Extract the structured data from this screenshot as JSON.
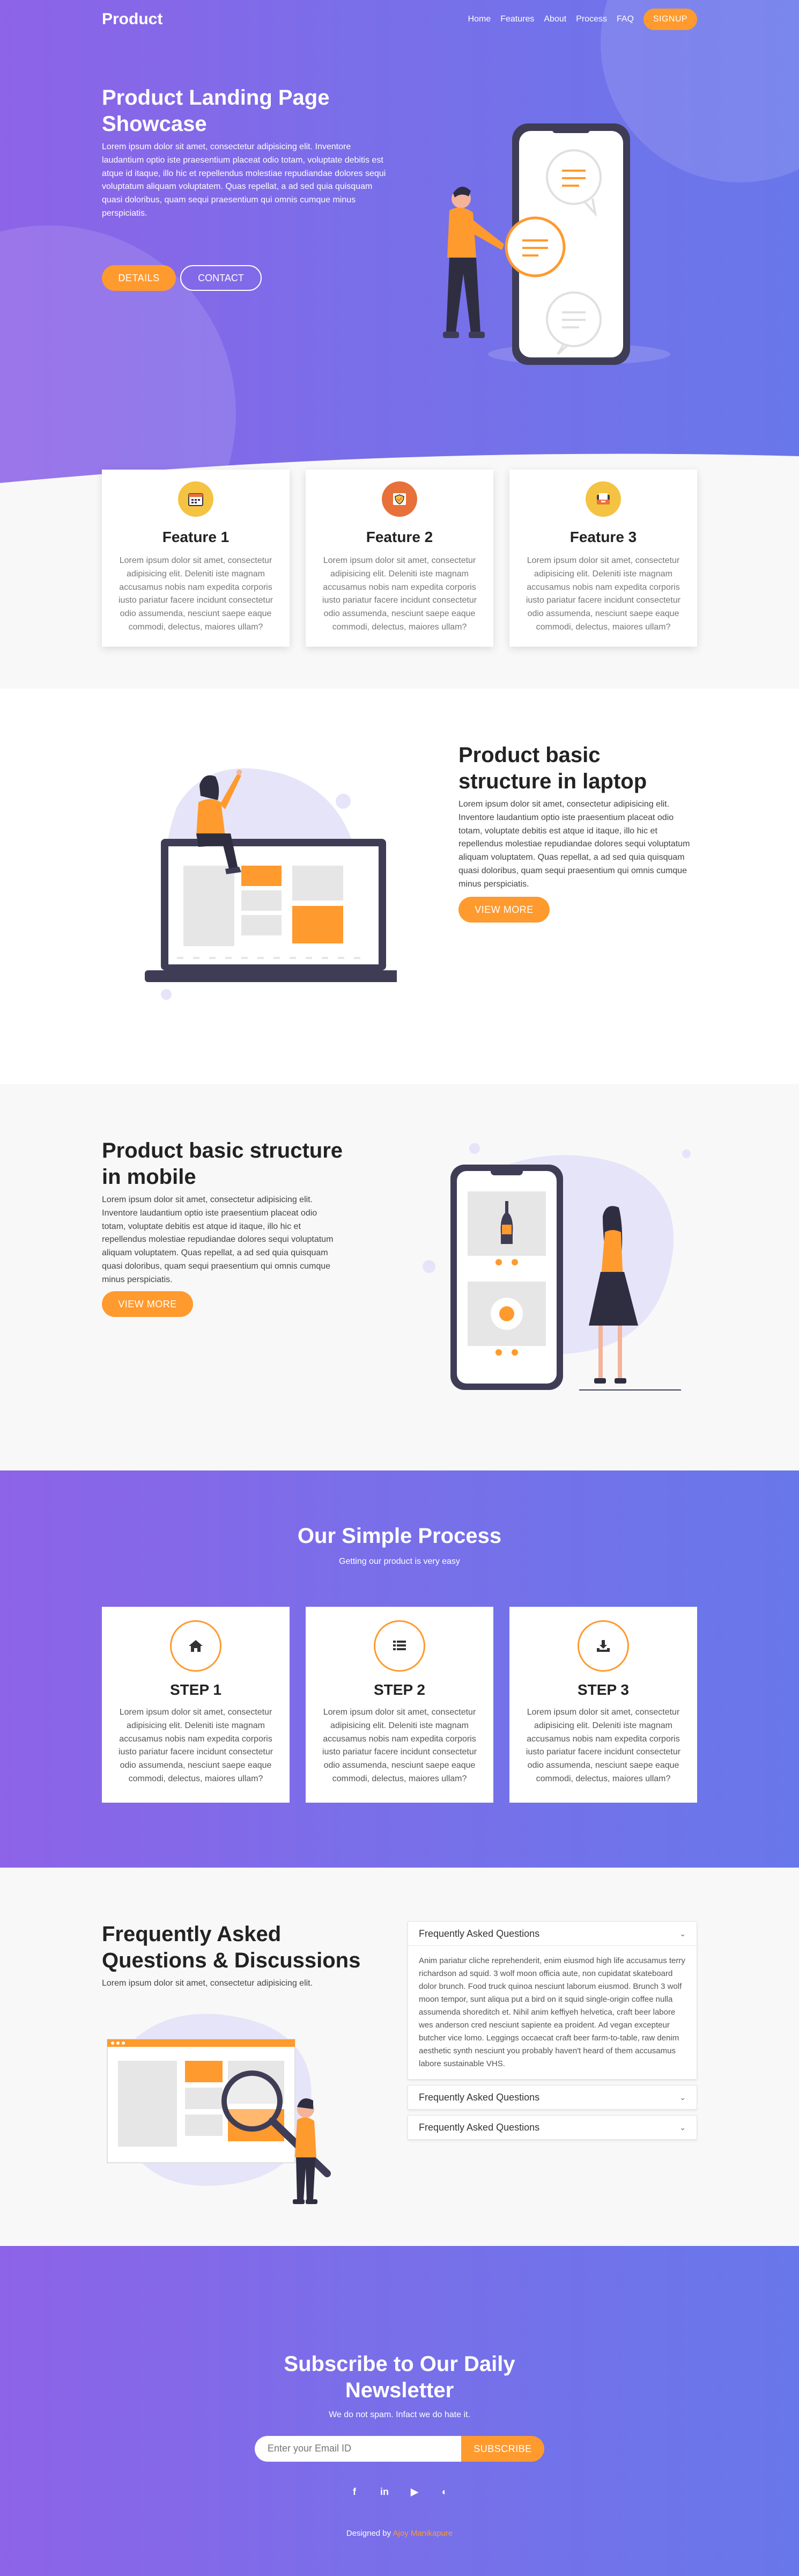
{
  "brand": "Product",
  "nav": {
    "items": [
      "Home",
      "Features",
      "About",
      "Process",
      "FAQ"
    ],
    "signup": "SIGNUP"
  },
  "hero": {
    "title": "Product Landing Page Showcase",
    "text": "Lorem ipsum dolor sit amet, consectetur adipisicing elit. Inventore laudantium optio iste praesentium placeat odio totam, voluptate debitis est atque id itaque, illo hic et repellendus molestiae repudiandae dolores sequi voluptatum aliquam voluptatem. Quas repellat, a ad sed quia quisquam quasi doloribus, quam sequi praesentium qui omnis cumque minus perspiciatis.",
    "details_btn": "DETAILS",
    "contact_btn": "CONTACT"
  },
  "features": [
    {
      "title": "Feature 1",
      "icon": "calendar-icon",
      "color": "#f5c342",
      "text": "Lorem ipsum dolor sit amet, consectetur adipisicing elit. Deleniti iste magnam accusamus nobis nam expedita corporis iusto pariatur facere incidunt consectetur odio assumenda, nesciunt saepe eaque commodi, delectus, maiores ullam?"
    },
    {
      "title": "Feature 2",
      "icon": "shield-icon",
      "color": "#e8703a",
      "text": "Lorem ipsum dolor sit amet, consectetur adipisicing elit. Deleniti iste magnam accusamus nobis nam expedita corporis iusto pariatur facere incidunt consectetur odio assumenda, nesciunt saepe eaque commodi, delectus, maiores ullam?"
    },
    {
      "title": "Feature 3",
      "icon": "inbox-icon",
      "color": "#f5c342",
      "text": "Lorem ipsum dolor sit amet, consectetur adipisicing elit. Deleniti iste magnam accusamus nobis nam expedita corporis iusto pariatur facere incidunt consectetur odio assumenda, nesciunt saepe eaque commodi, delectus, maiores ullam?"
    }
  ],
  "laptop": {
    "title": "Product basic structure in laptop",
    "text": "Lorem ipsum dolor sit amet, consectetur adipisicing elit. Inventore laudantium optio iste praesentium placeat odio totam, voluptate debitis est atque id itaque, illo hic et repellendus molestiae repudiandae dolores sequi voluptatum aliquam voluptatem. Quas repellat, a ad sed quia quisquam quasi doloribus, quam sequi praesentium qui omnis cumque minus perspiciatis.",
    "btn": "VIEW MORE"
  },
  "mobile": {
    "title": "Product basic structure in mobile",
    "text": "Lorem ipsum dolor sit amet, consectetur adipisicing elit. Inventore laudantium optio iste praesentium placeat odio totam, voluptate debitis est atque id itaque, illo hic et repellendus molestiae repudiandae dolores sequi voluptatum aliquam voluptatem. Quas repellat, a ad sed quia quisquam quasi doloribus, quam sequi praesentium qui omnis cumque minus perspiciatis.",
    "btn": "VIEW MORE"
  },
  "process": {
    "title": "Our Simple Process",
    "subtitle": "Getting our product is very easy",
    "steps": [
      {
        "title": "STEP 1",
        "icon": "home-icon",
        "text": "Lorem ipsum dolor sit amet, consectetur adipisicing elit. Deleniti iste magnam accusamus nobis nam expedita corporis iusto pariatur facere incidunt consectetur odio assumenda, nesciunt saepe eaque commodi, delectus, maiores ullam?"
      },
      {
        "title": "STEP 2",
        "icon": "list-icon",
        "text": "Lorem ipsum dolor sit amet, consectetur adipisicing elit. Deleniti iste magnam accusamus nobis nam expedita corporis iusto pariatur facere incidunt consectetur odio assumenda, nesciunt saepe eaque commodi, delectus, maiores ullam?"
      },
      {
        "title": "STEP 3",
        "icon": "download-icon",
        "text": "Lorem ipsum dolor sit amet, consectetur adipisicing elit. Deleniti iste magnam accusamus nobis nam expedita corporis iusto pariatur facere incidunt consectetur odio assumenda, nesciunt saepe eaque commodi, delectus, maiores ullam?"
      }
    ]
  },
  "faq": {
    "title": "Frequently Asked Questions & Discussions",
    "text": "Lorem ipsum dolor sit amet, consectetur adipisicing elit.",
    "items": [
      {
        "q": "Frequently Asked Questions",
        "a": "Anim pariatur cliche reprehenderit, enim eiusmod high life accusamus terry richardson ad squid. 3 wolf moon officia aute, non cupidatat skateboard dolor brunch. Food truck quinoa nesciunt laborum eiusmod. Brunch 3 wolf moon tempor, sunt aliqua put a bird on it squid single-origin coffee nulla assumenda shoreditch et. Nihil anim keffiyeh helvetica, craft beer labore wes anderson cred nesciunt sapiente ea proident. Ad vegan excepteur butcher vice lomo. Leggings occaecat craft beer farm-to-table, raw denim aesthetic synth nesciunt you probably haven't heard of them accusamus labore sustainable VHS."
      },
      {
        "q": "Frequently Asked Questions"
      },
      {
        "q": "Frequently Asked Questions"
      }
    ]
  },
  "subscribe": {
    "title": "Subscribe to Our Daily Newsletter",
    "subtitle": "We do not spam. Infact we do hate it.",
    "placeholder": "Enter your Email ID",
    "btn": "SUBSCRIBE",
    "socials": [
      "facebook-icon",
      "linkedin-icon",
      "youtube-icon",
      "dribbble-icon"
    ],
    "credit_prefix": "Designed by",
    "credit_author": "Ajoy Manikapure"
  },
  "colors": {
    "accent": "#ff9a2e",
    "grad_start": "#8d63e8",
    "grad_end": "#6877ea"
  }
}
